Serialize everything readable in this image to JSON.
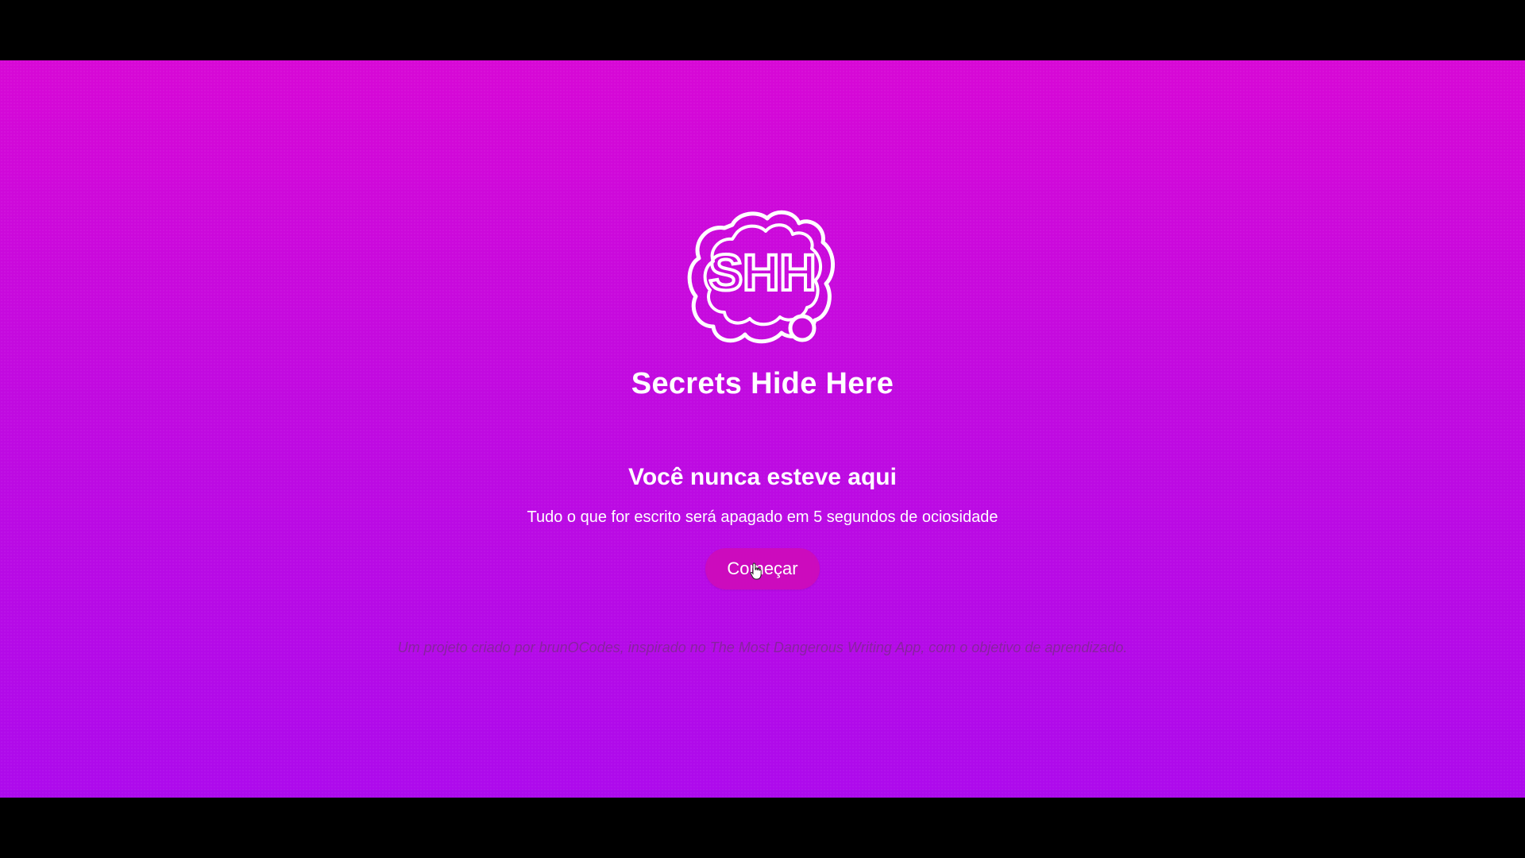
{
  "app": {
    "title": "Secrets Hide Here",
    "logo_text": "SHH"
  },
  "hero": {
    "headline": "Você nunca esteve aqui",
    "subtitle": "Tudo o que for escrito será apagado em 5 segundos de ociosidade",
    "start_button_label": "Começar"
  },
  "footer": {
    "prefix": "Um projeto criado por brunOCodes, inspirado no ",
    "reference": "The Most Dangerous Writing App",
    "suffix": ", com o objetivo de aprendizado."
  },
  "colors": {
    "gradient_top": "#d708d6",
    "gradient_bottom": "#ad0aec",
    "button_bg": "#cc0bbd",
    "text": "#ffffff"
  },
  "icons": {
    "logo": "shh-cloud-logo",
    "cursor": "hand-pointer-cursor"
  }
}
